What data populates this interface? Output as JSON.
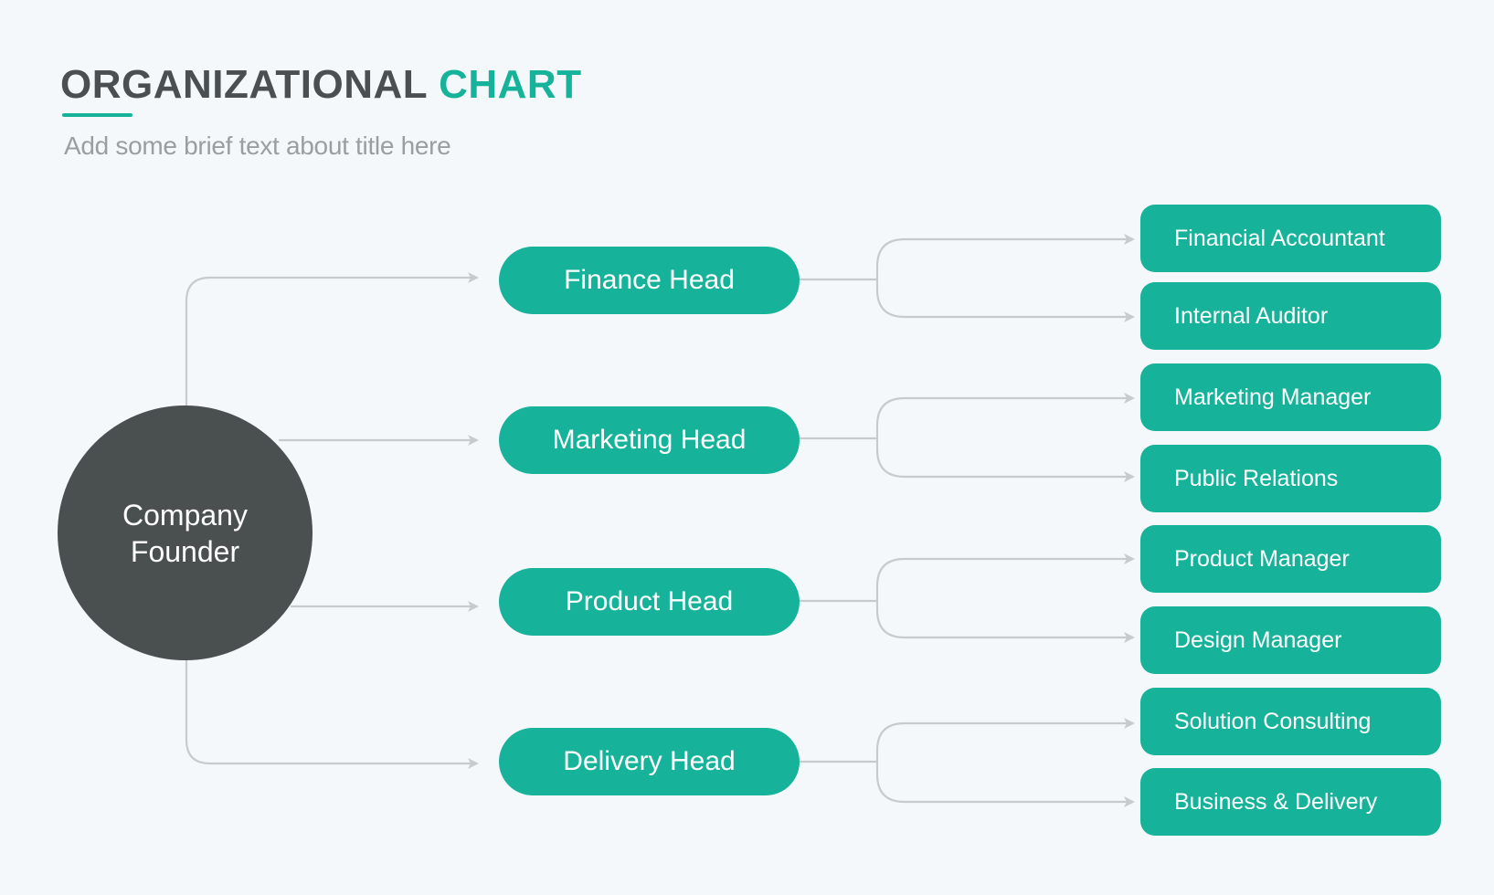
{
  "header": {
    "title_main": "ORGANIZATIONAL",
    "title_accent": "CHART",
    "subtitle": "Add some brief text about title here"
  },
  "colors": {
    "accent": "#16B39A",
    "dark": "#4A4F50",
    "background": "#F4F8FB",
    "connector": "#C8CBCE",
    "subtitle": "#9A9EA2"
  },
  "org": {
    "root": {
      "label": "Company Founder"
    },
    "heads": [
      {
        "label": "Finance Head",
        "reports": [
          "Financial Accountant",
          "Internal Auditor"
        ]
      },
      {
        "label": "Marketing Head",
        "reports": [
          "Marketing Manager",
          "Public Relations"
        ]
      },
      {
        "label": "Product Head",
        "reports": [
          "Product Manager",
          "Design Manager"
        ]
      },
      {
        "label": "Delivery Head",
        "reports": [
          "Solution Consulting",
          "Business & Delivery"
        ]
      }
    ]
  }
}
